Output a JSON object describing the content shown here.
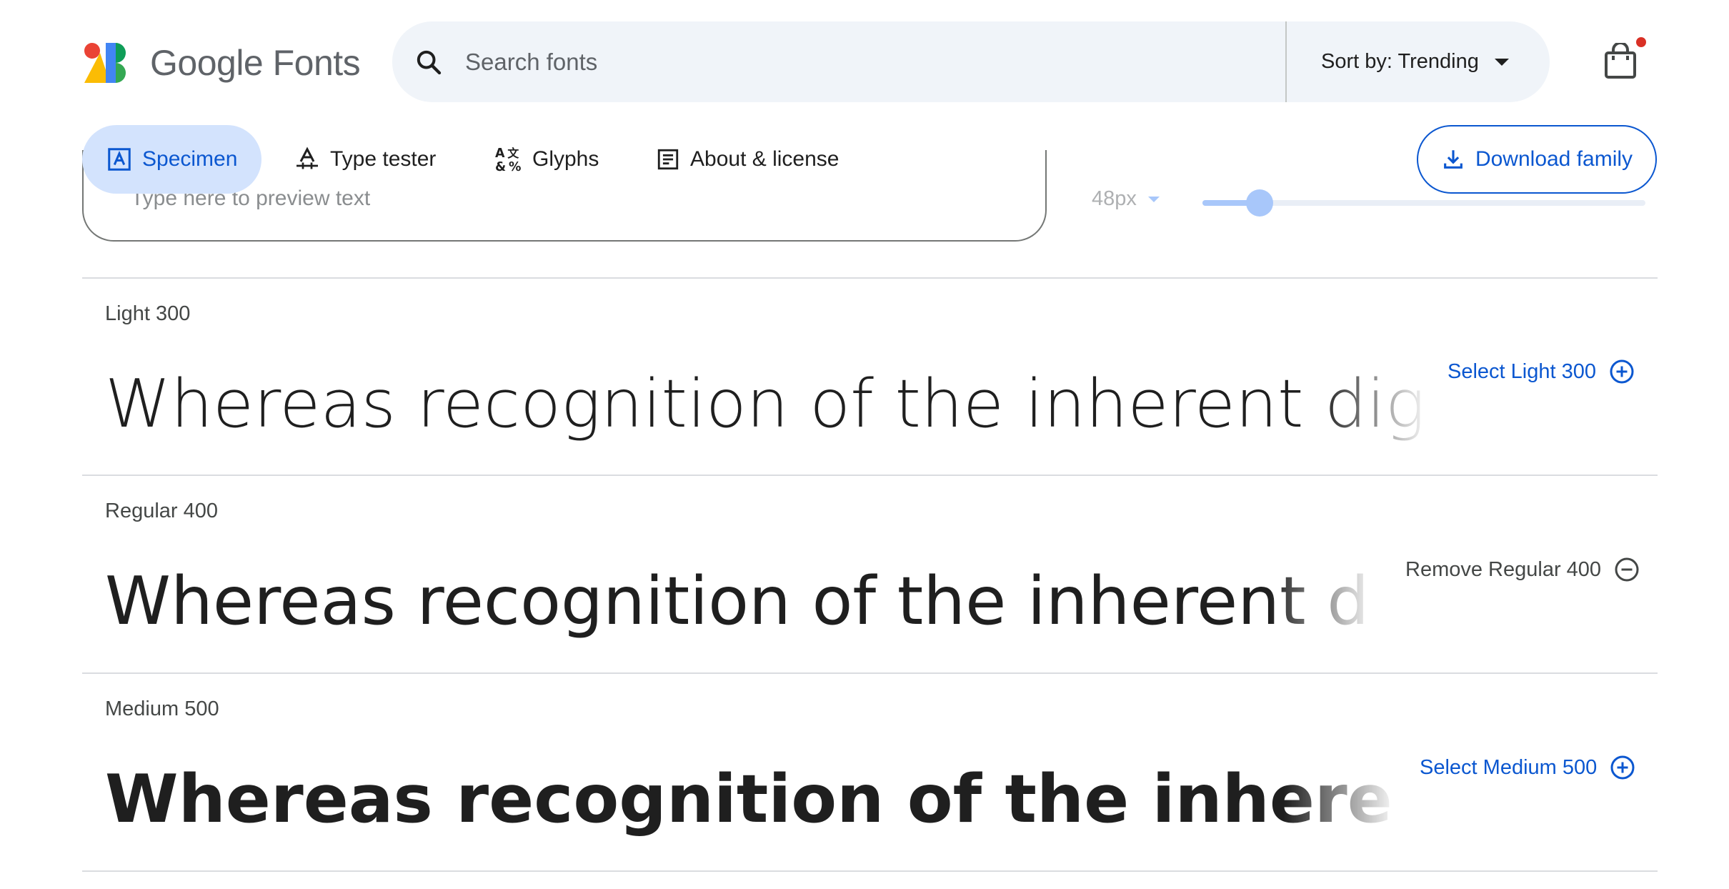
{
  "header": {
    "logo_text": "Google Fonts",
    "search_placeholder": "Search fonts",
    "sort_label": "Sort by: Trending",
    "cart_has_items": true
  },
  "tabs": [
    {
      "label": "Specimen",
      "icon": "specimen-icon",
      "active": true
    },
    {
      "label": "Type tester",
      "icon": "type-tester-icon",
      "active": false
    },
    {
      "label": "Glyphs",
      "icon": "glyphs-icon",
      "active": false
    },
    {
      "label": "About & license",
      "icon": "about-icon",
      "active": false
    }
  ],
  "download_label": "Download family",
  "preview": {
    "placeholder": "Type here to preview text",
    "size_label": "48px",
    "slider_level_fraction": 0.1
  },
  "styles": [
    {
      "label": "Light 300",
      "sample": "Whereas recognition of the inherent dig",
      "action": "Select Light 300",
      "selected": false
    },
    {
      "label": "Regular 400",
      "sample": "Whereas recognition of the inherent d",
      "action": "Remove Regular 400",
      "selected": true
    },
    {
      "label": "Medium 500",
      "sample": "Whereas recognition of the inherent di",
      "action": "Select Medium 500",
      "selected": false
    }
  ],
  "colors": {
    "accent": "#0b57d0",
    "search_bg": "#f0f4f9",
    "active_tab_bg": "#d3e3fd",
    "notification_dot": "#d93025"
  }
}
